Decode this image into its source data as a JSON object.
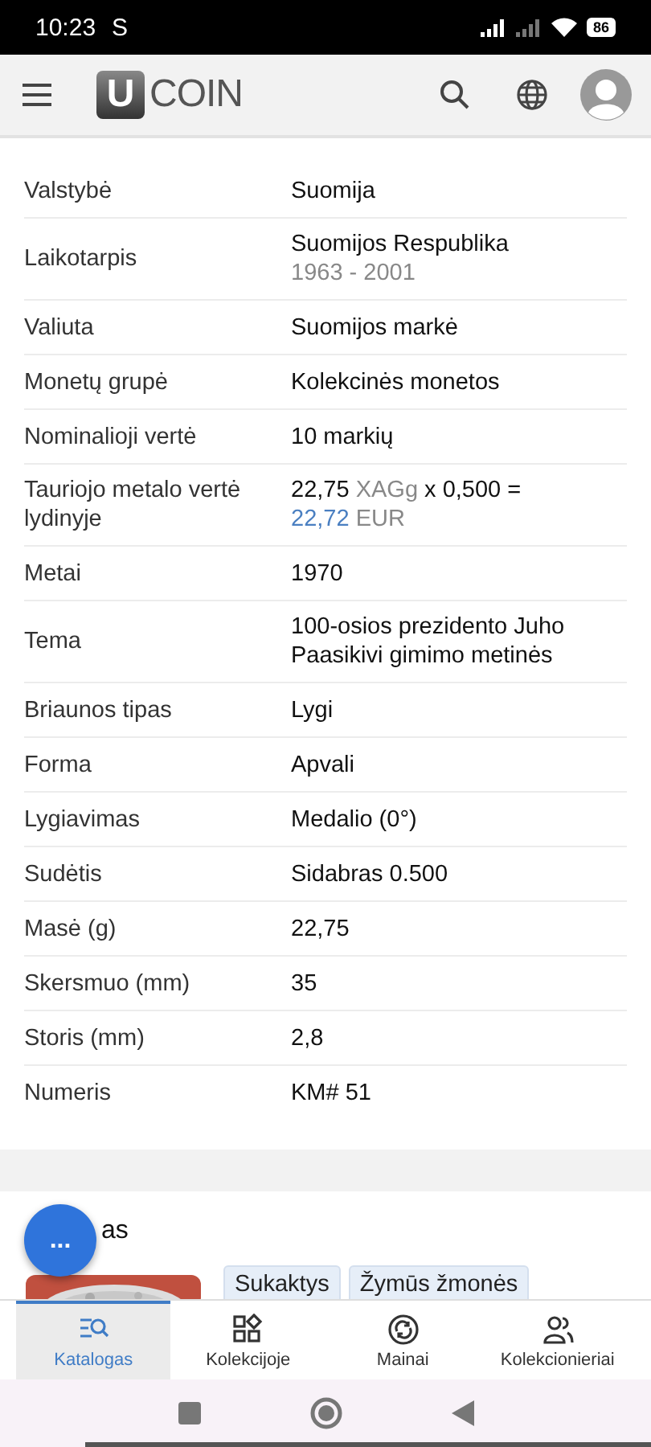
{
  "status_bar": {
    "time": "10:23",
    "carrier_letter": "S",
    "battery": "86"
  },
  "app_bar": {
    "logo_letter": "U",
    "logo_text": "COIN"
  },
  "details": [
    {
      "label": "Valstybė",
      "lines": [
        [
          {
            "text": "Suomija",
            "kind": "plain"
          }
        ]
      ]
    },
    {
      "label": "Laikotarpis",
      "lines": [
        [
          {
            "text": "Suomijos Respublika",
            "kind": "plain"
          }
        ],
        [
          {
            "text": "1963 - 2001",
            "kind": "muted"
          }
        ]
      ]
    },
    {
      "label": "Valiuta",
      "lines": [
        [
          {
            "text": "Suomijos markė",
            "kind": "plain"
          }
        ]
      ]
    },
    {
      "label": "Monetų grupė",
      "lines": [
        [
          {
            "text": "Kolekcinės monetos",
            "kind": "plain"
          }
        ]
      ]
    },
    {
      "label": "Nominalioji vertė",
      "lines": [
        [
          {
            "text": "10 markių",
            "kind": "plain"
          }
        ]
      ]
    },
    {
      "label": "Tauriojo metalo vertė lydinyje",
      "lines": [
        [
          {
            "text": "22,75",
            "kind": "plain"
          },
          {
            "text": "XAGg",
            "kind": "muted"
          },
          {
            "text": "x 0,500 =",
            "kind": "plain"
          }
        ],
        [
          {
            "text": "22,72",
            "kind": "link"
          },
          {
            "text": "EUR",
            "kind": "muted"
          }
        ]
      ]
    },
    {
      "label": "Metai",
      "lines": [
        [
          {
            "text": "1970",
            "kind": "plain"
          }
        ]
      ]
    },
    {
      "label": "Tema",
      "lines": [
        [
          {
            "text": "100-osios prezidento Juho Paasikivi gimimo metinės",
            "kind": "plain"
          }
        ]
      ]
    },
    {
      "label": "Briaunos tipas",
      "lines": [
        [
          {
            "text": "Lygi",
            "kind": "plain"
          }
        ]
      ]
    },
    {
      "label": "Forma",
      "lines": [
        [
          {
            "text": "Apvali",
            "kind": "plain"
          }
        ]
      ]
    },
    {
      "label": "Lygiavimas",
      "lines": [
        [
          {
            "text": "Medalio (0°)",
            "kind": "plain"
          }
        ]
      ]
    },
    {
      "label": "Sudėtis",
      "lines": [
        [
          {
            "text": "Sidabras 0.500",
            "kind": "plain"
          }
        ]
      ]
    },
    {
      "label": "Masė (g)",
      "lines": [
        [
          {
            "text": "22,75",
            "kind": "plain"
          }
        ]
      ]
    },
    {
      "label": "Skersmuo (mm)",
      "lines": [
        [
          {
            "text": "35",
            "kind": "plain"
          }
        ]
      ]
    },
    {
      "label": "Storis (mm)",
      "lines": [
        [
          {
            "text": "2,8",
            "kind": "plain"
          }
        ]
      ]
    },
    {
      "label": "Numeris",
      "lines": [
        [
          {
            "text": "KM# 51",
            "kind": "plain"
          }
        ]
      ]
    }
  ],
  "section": {
    "title_visible": "as",
    "fab": "...",
    "tags": [
      "Sukaktys",
      "Žymūs žmonės"
    ]
  },
  "bottom_nav": [
    {
      "label": "Katalogas",
      "kind": "catalog",
      "selected": true
    },
    {
      "label": "Kolekcijoje",
      "kind": "collection",
      "selected": false
    },
    {
      "label": "Mainai",
      "kind": "exchange",
      "selected": false
    },
    {
      "label": "Kolekcionieriai",
      "kind": "people",
      "selected": false
    }
  ]
}
